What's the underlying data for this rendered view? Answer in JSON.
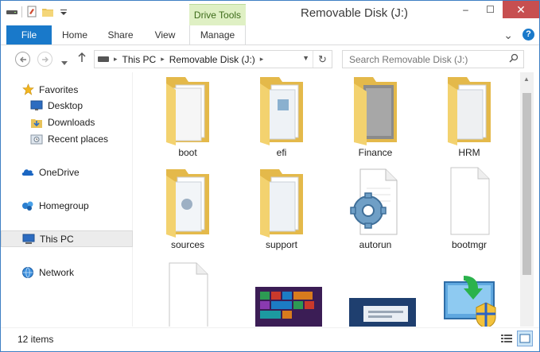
{
  "window": {
    "title": "Removable Disk (J:)",
    "context_tab": "Drive Tools",
    "controls": {
      "minimize": "–",
      "maximize": "☐",
      "close": "✕"
    }
  },
  "ribbon": {
    "tabs": [
      {
        "label": "File"
      },
      {
        "label": "Home"
      },
      {
        "label": "Share"
      },
      {
        "label": "View"
      },
      {
        "label": "Manage"
      }
    ],
    "expand_glyph": "⌄",
    "help_glyph": "?"
  },
  "address": {
    "crumbs": [
      "This PC",
      "Removable Disk (J:)"
    ],
    "search_placeholder": "Search Removable Disk (J:)"
  },
  "sidebar": {
    "items": [
      {
        "label": "Favorites",
        "icon": "star-icon"
      },
      {
        "label": "Desktop",
        "icon": "desktop-icon"
      },
      {
        "label": "Downloads",
        "icon": "downloads-icon"
      },
      {
        "label": "Recent places",
        "icon": "recent-places-icon"
      },
      {
        "label": "OneDrive",
        "icon": "onedrive-icon"
      },
      {
        "label": "Homegroup",
        "icon": "homegroup-icon"
      },
      {
        "label": "This PC",
        "icon": "this-pc-icon",
        "selected": true
      },
      {
        "label": "Network",
        "icon": "network-icon"
      }
    ]
  },
  "files": [
    {
      "name": "boot",
      "type": "folder"
    },
    {
      "name": "efi",
      "type": "folder"
    },
    {
      "name": "Finance",
      "type": "folder"
    },
    {
      "name": "HRM",
      "type": "folder"
    },
    {
      "name": "sources",
      "type": "folder"
    },
    {
      "name": "support",
      "type": "folder"
    },
    {
      "name": "autorun",
      "type": "settings-file"
    },
    {
      "name": "bootmgr",
      "type": "blank-file"
    },
    {
      "name": "",
      "type": "blank-file"
    },
    {
      "name": "",
      "type": "image-file"
    },
    {
      "name": "",
      "type": "image-file"
    },
    {
      "name": "",
      "type": "setup-app"
    }
  ],
  "status": {
    "item_count": "12 items"
  },
  "colors": {
    "accent": "#1979ca",
    "context_tab": "#dff0c4",
    "close_button": "#c74f50"
  }
}
